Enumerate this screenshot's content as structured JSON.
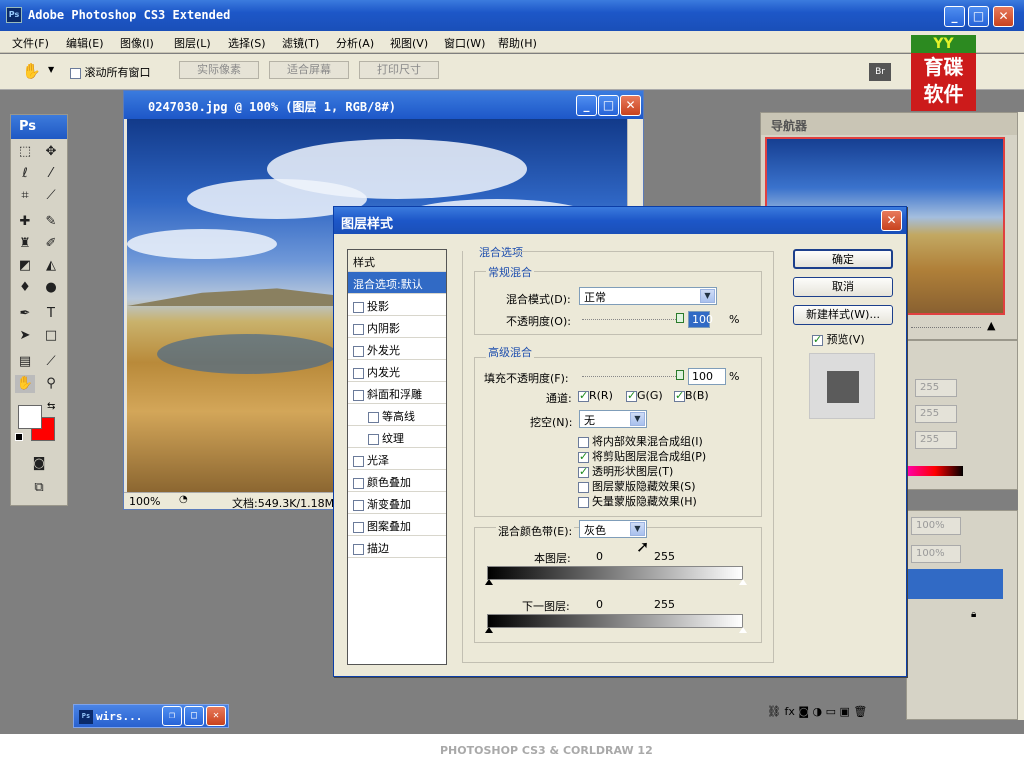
{
  "window": {
    "app_icon": "Ps",
    "title": "Adobe Photoshop CS3 Extended",
    "min": "_",
    "max": "□",
    "close": "✕"
  },
  "menu": [
    "文件(F)",
    "编辑(E)",
    "图像(I)",
    "图层(L)",
    "选择(S)",
    "滤镜(T)",
    "分析(A)",
    "视图(V)",
    "窗口(W)",
    "帮助(H)"
  ],
  "options": {
    "scroll_all_windows": "滚动所有窗口",
    "actual_pixels": "实际像素",
    "fit_screen": "适合屏幕",
    "print_size": "打印尺寸"
  },
  "logo": {
    "top": "YY",
    "text1": "育碟",
    "text2": "软件"
  },
  "toolbox": {
    "header": "Ps"
  },
  "document": {
    "title": "0247030.jpg @ 100% (图层 1, RGB/8#)",
    "zoom": "100%",
    "doc_info": "文档:549.3K/1.18M"
  },
  "navigator": {
    "title": "导航器"
  },
  "right_panels": {
    "vals": [
      "255",
      "255",
      "255"
    ],
    "opacity1": "100%",
    "opacity2": "100%"
  },
  "dialog": {
    "title": "图层样式",
    "close": "✕",
    "styles_header": "样式",
    "style_items": [
      {
        "label": "混合选项:默认",
        "selected": true,
        "checkbox": false,
        "indent": false
      },
      {
        "label": "投影",
        "selected": false,
        "checkbox": true,
        "indent": false
      },
      {
        "label": "内阴影",
        "selected": false,
        "checkbox": true,
        "indent": false
      },
      {
        "label": "外发光",
        "selected": false,
        "checkbox": true,
        "indent": false
      },
      {
        "label": "内发光",
        "selected": false,
        "checkbox": true,
        "indent": false
      },
      {
        "label": "斜面和浮雕",
        "selected": false,
        "checkbox": true,
        "indent": false
      },
      {
        "label": "等高线",
        "selected": false,
        "checkbox": true,
        "indent": true
      },
      {
        "label": "纹理",
        "selected": false,
        "checkbox": true,
        "indent": true
      },
      {
        "label": "光泽",
        "selected": false,
        "checkbox": true,
        "indent": false
      },
      {
        "label": "颜色叠加",
        "selected": false,
        "checkbox": true,
        "indent": false
      },
      {
        "label": "渐变叠加",
        "selected": false,
        "checkbox": true,
        "indent": false
      },
      {
        "label": "图案叠加",
        "selected": false,
        "checkbox": true,
        "indent": false
      },
      {
        "label": "描边",
        "selected": false,
        "checkbox": true,
        "indent": false
      }
    ],
    "blend_options_title": "混合选项",
    "general_blending": "常规混合",
    "blend_mode_label": "混合模式(D):",
    "blend_mode_value": "正常",
    "opacity_label": "不透明度(O):",
    "opacity_value": "100",
    "percent": "%",
    "advanced_blending": "高级混合",
    "fill_opacity_label": "填充不透明度(F):",
    "fill_opacity_value": "100",
    "channels_label": "通道:",
    "channel_r": "R(R)",
    "channel_g": "G(G)",
    "channel_b": "B(B)",
    "knockout_label": "挖空(N):",
    "knockout_value": "无",
    "adv_checks": [
      {
        "label": "将内部效果混合成组(I)",
        "checked": false
      },
      {
        "label": "将剪贴图层混合成组(P)",
        "checked": true
      },
      {
        "label": "透明形状图层(T)",
        "checked": true
      },
      {
        "label": "图层蒙版隐藏效果(S)",
        "checked": false
      },
      {
        "label": "矢量蒙版隐藏效果(H)",
        "checked": false
      }
    ],
    "blend_if_label": "混合颜色带(E):",
    "blend_if_value": "灰色",
    "this_layer_label": "本图层:",
    "this_layer_min": "0",
    "this_layer_max": "255",
    "underlying_label": "下一图层:",
    "underlying_min": "0",
    "underlying_max": "255",
    "ok": "确定",
    "cancel": "取消",
    "new_style": "新建样式(W)...",
    "preview_label": "预览(V)"
  },
  "minimized": {
    "icon": "Ps",
    "title": "wirs..."
  },
  "footer_brand": "PHOTOSHOP CS3 & CORLDRAW 12"
}
